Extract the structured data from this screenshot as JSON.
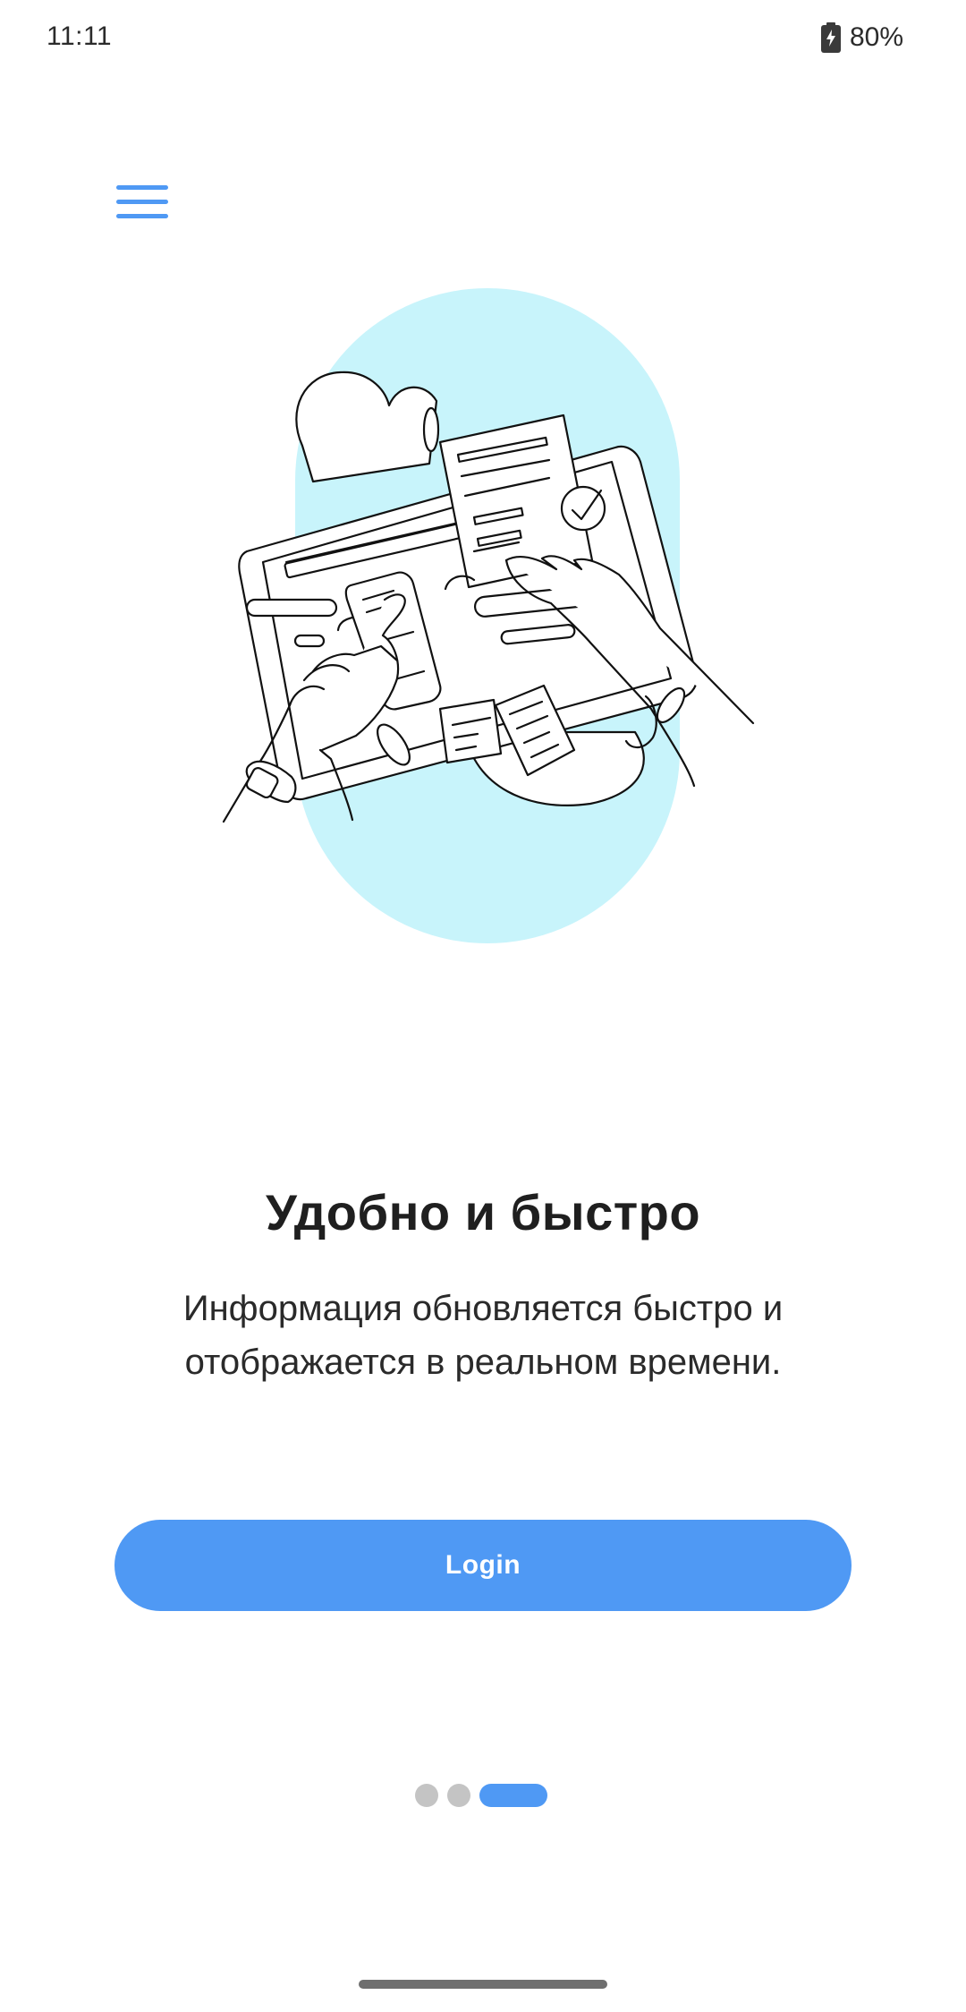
{
  "status_bar": {
    "time": "11:11",
    "battery_percent": "80%",
    "battery_icon": "battery-charging-icon"
  },
  "menu": {
    "icon": "hamburger-menu-icon",
    "color": "#4f99f4"
  },
  "illustration": {
    "description_icon": "hands-with-documents-illustration",
    "background_color": "#c8f4fb"
  },
  "slide": {
    "title": "Удобно и быстро",
    "text": "Информация обновляется быстро и отображается в реальном времени."
  },
  "login_button": {
    "label": "Login",
    "color": "#4f99f4"
  },
  "pager": {
    "total": 3,
    "active_index": 2,
    "active_color": "#4f99f4",
    "inactive_color": "#c4c4c4"
  }
}
